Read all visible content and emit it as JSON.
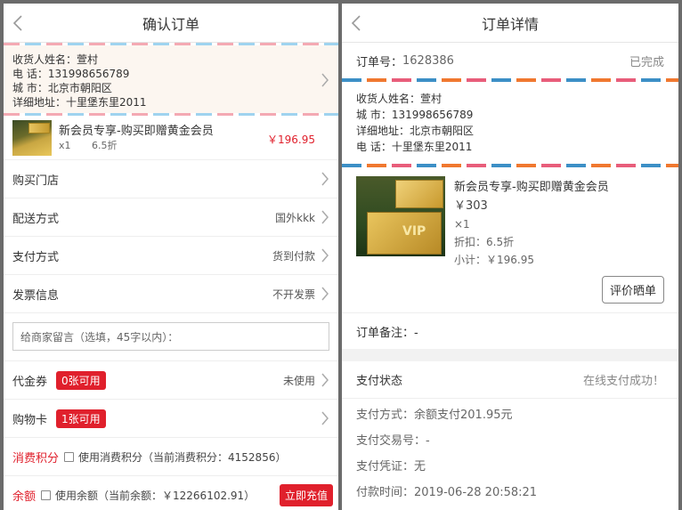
{
  "left": {
    "title": "确认订单",
    "address": {
      "name": "收货人姓名：萱村",
      "phone": "电 话：131998656789",
      "city": "城 市：北京市朝阳区",
      "detail": "详细地址：十里堡东里2011"
    },
    "product": {
      "name": "新会员专享-购买即赠黄金会员",
      "qty": "x1",
      "discount": "6.5折",
      "price": "￥196.95"
    },
    "rows": {
      "store": "购买门店",
      "delivery_label": "配送方式",
      "delivery_value": "国外kkk",
      "payment_label": "支付方式",
      "payment_value": "货到付款",
      "invoice_label": "发票信息",
      "invoice_value": "不开发票"
    },
    "message_placeholder": "给商家留言（选填，45字以内）：",
    "voucher": {
      "label": "代金券",
      "badge": "0张可用",
      "value": "未使用"
    },
    "card": {
      "label": "购物卡",
      "badge": "1张可用"
    },
    "points": {
      "label": "消费积分",
      "text": "使用消费积分（当前消费积分：4152856）"
    },
    "balance": {
      "label": "余额",
      "text": "使用余额（当前余额：￥12266102.91）",
      "button": "立即充值"
    }
  },
  "right": {
    "title": "订单详情",
    "order_no_label": "订单号：",
    "order_no": "1628386",
    "status": "已完成",
    "address": {
      "name": "收货人姓名：萱村",
      "city": "城 市：131998656789",
      "detail": "详细地址：北京市朝阳区",
      "phone": "电 话：十里堡东里2011"
    },
    "product": {
      "name": "新会员专享-购买即赠黄金会员",
      "price": "￥303",
      "qty": "×1",
      "discount": "折扣：6.5折",
      "subtotal": "小计：￥196.95",
      "review_button": "评价晒单"
    },
    "remark": "订单备注：-",
    "pay_status_label": "支付状态",
    "pay_status_value": "在线支付成功！",
    "pay_method": "支付方式：余额支付201.95元",
    "pay_trade_no": "支付交易号：-",
    "pay_voucher": "支付凭证：无",
    "pay_time": "付款时间：2019-06-28 20:58:21"
  }
}
